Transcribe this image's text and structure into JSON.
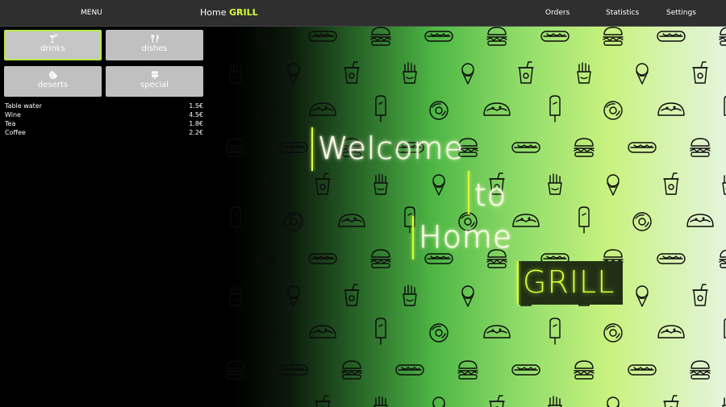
{
  "topbar": {
    "menu_label": "MENU",
    "brand_prefix": "Home",
    "brand_accent": "GRILL",
    "orders_label": "Orders",
    "statistics_label": "Statistics",
    "settings_label": "Settings"
  },
  "categories": [
    {
      "label": "drinks",
      "icon": "cocktail-icon",
      "active": true
    },
    {
      "label": "dishes",
      "icon": "fork-knife-icon",
      "active": false
    },
    {
      "label": "deserts",
      "icon": "cookie-icon",
      "active": false
    },
    {
      "label": "special",
      "icon": "signpost-icon",
      "active": false
    }
  ],
  "items": [
    {
      "name": "Table water",
      "price": "1.5€"
    },
    {
      "name": "Wine",
      "price": "4.5€"
    },
    {
      "name": "Tea",
      "price": "1.8€"
    },
    {
      "name": "Coffee",
      "price": "2.2€"
    }
  ],
  "hero": {
    "line1": "Welcome",
    "line2": "to",
    "line3": "Home",
    "line4": "GRILL"
  },
  "colors": {
    "accent": "#d8ff3a",
    "topbar": "#2f2f2f",
    "category_bg": "#c0c0c0"
  }
}
